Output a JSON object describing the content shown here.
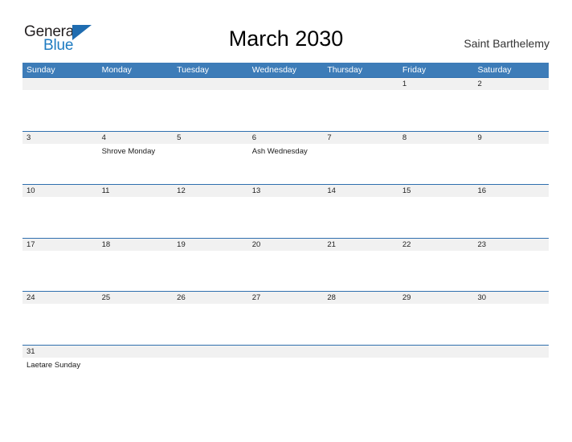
{
  "brand": {
    "word_one": "General",
    "word_two": "Blue",
    "color_dark": "#231f20",
    "color_blue": "#1e7bc1",
    "triangle_color": "#1f6cb0",
    "triangle_icon": "triangle-flag-icon"
  },
  "header": {
    "title": "March 2030",
    "region": "Saint Barthelemy"
  },
  "calendar": {
    "header_bg": "#3d7cb8",
    "band_bg": "#f1f1f1",
    "rule_color": "#2f6fae",
    "weekday_headers": [
      "Sunday",
      "Monday",
      "Tuesday",
      "Wednesday",
      "Thursday",
      "Friday",
      "Saturday"
    ],
    "weeks": [
      {
        "days": [
          {
            "date": "",
            "event": ""
          },
          {
            "date": "",
            "event": ""
          },
          {
            "date": "",
            "event": ""
          },
          {
            "date": "",
            "event": ""
          },
          {
            "date": "",
            "event": ""
          },
          {
            "date": "1",
            "event": ""
          },
          {
            "date": "2",
            "event": ""
          }
        ]
      },
      {
        "days": [
          {
            "date": "3",
            "event": ""
          },
          {
            "date": "4",
            "event": "Shrove Monday"
          },
          {
            "date": "5",
            "event": ""
          },
          {
            "date": "6",
            "event": "Ash Wednesday"
          },
          {
            "date": "7",
            "event": ""
          },
          {
            "date": "8",
            "event": ""
          },
          {
            "date": "9",
            "event": ""
          }
        ]
      },
      {
        "days": [
          {
            "date": "10",
            "event": ""
          },
          {
            "date": "11",
            "event": ""
          },
          {
            "date": "12",
            "event": ""
          },
          {
            "date": "13",
            "event": ""
          },
          {
            "date": "14",
            "event": ""
          },
          {
            "date": "15",
            "event": ""
          },
          {
            "date": "16",
            "event": ""
          }
        ]
      },
      {
        "days": [
          {
            "date": "17",
            "event": ""
          },
          {
            "date": "18",
            "event": ""
          },
          {
            "date": "19",
            "event": ""
          },
          {
            "date": "20",
            "event": ""
          },
          {
            "date": "21",
            "event": ""
          },
          {
            "date": "22",
            "event": ""
          },
          {
            "date": "23",
            "event": ""
          }
        ]
      },
      {
        "days": [
          {
            "date": "24",
            "event": ""
          },
          {
            "date": "25",
            "event": ""
          },
          {
            "date": "26",
            "event": ""
          },
          {
            "date": "27",
            "event": ""
          },
          {
            "date": "28",
            "event": ""
          },
          {
            "date": "29",
            "event": ""
          },
          {
            "date": "30",
            "event": ""
          }
        ]
      },
      {
        "days": [
          {
            "date": "31",
            "event": "Laetare Sunday"
          },
          {
            "date": "",
            "event": ""
          },
          {
            "date": "",
            "event": ""
          },
          {
            "date": "",
            "event": ""
          },
          {
            "date": "",
            "event": ""
          },
          {
            "date": "",
            "event": ""
          },
          {
            "date": "",
            "event": ""
          }
        ]
      }
    ]
  }
}
